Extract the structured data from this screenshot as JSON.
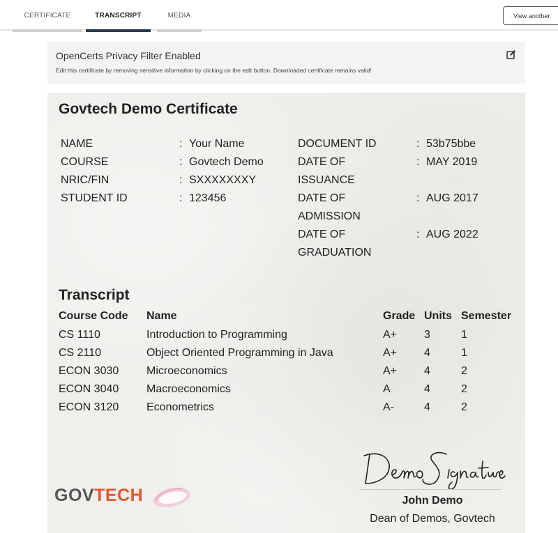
{
  "tabs": [
    {
      "label": "CERTIFICATE",
      "active": false
    },
    {
      "label": "TRANSCRIPT",
      "active": true
    },
    {
      "label": "MEDIA",
      "active": false
    }
  ],
  "view_another_label": "View another",
  "privacy": {
    "title": "OpenCerts Privacy Filter Enabled",
    "description": "Edit this certificate by removing sensitive information by clicking on the edit button. Downloaded certificate remains valid!",
    "edit_icon": "edit-icon"
  },
  "certificate": {
    "title": "Govtech Demo Certificate",
    "left_fields": [
      {
        "label": "NAME",
        "value": "Your Name"
      },
      {
        "label": "COURSE",
        "value": "Govtech Demo"
      },
      {
        "label": "NRIC/FIN",
        "value": "SXXXXXXXY"
      },
      {
        "label": "STUDENT ID",
        "value": "123456"
      }
    ],
    "right_fields": [
      {
        "label_lines": [
          "DOCUMENT ID"
        ],
        "value": "53b75bbe"
      },
      {
        "label_lines": [
          "DATE OF",
          "ISSUANCE"
        ],
        "value": "MAY 2019"
      },
      {
        "label_lines": [
          "DATE OF",
          "ADMISSION"
        ],
        "value": "AUG 2017"
      },
      {
        "label_lines": [
          "DATE OF",
          "GRADUATION"
        ],
        "value": "AUG 2022"
      }
    ],
    "colon": ":"
  },
  "transcript": {
    "title": "Transcript",
    "headers": {
      "code": "Course Code",
      "name": "Name",
      "grade": "Grade",
      "units": "Units",
      "semester": "Semester"
    },
    "rows": [
      {
        "code": "CS 1110",
        "name": "Introduction to Programming",
        "grade": "A+",
        "units": "3",
        "semester": "1"
      },
      {
        "code": "CS 2110",
        "name": "Object Oriented Programming in Java",
        "grade": "A+",
        "units": "4",
        "semester": "1"
      },
      {
        "code": "ECON 3030",
        "name": "Microeconomics",
        "grade": "A+",
        "units": "4",
        "semester": "2"
      },
      {
        "code": "ECON 3040",
        "name": "Macroeconomics",
        "grade": "A",
        "units": "4",
        "semester": "2"
      },
      {
        "code": "ECON 3120",
        "name": "Econometrics",
        "grade": "A-",
        "units": "4",
        "semester": "2"
      }
    ]
  },
  "logo": {
    "part1": "GOV",
    "part2": "TECH",
    "accent_color": "#e8562a"
  },
  "signature": {
    "signature_text": "DemoSignature",
    "name": "John Demo",
    "title": "Dean of Demos, Govtech"
  }
}
